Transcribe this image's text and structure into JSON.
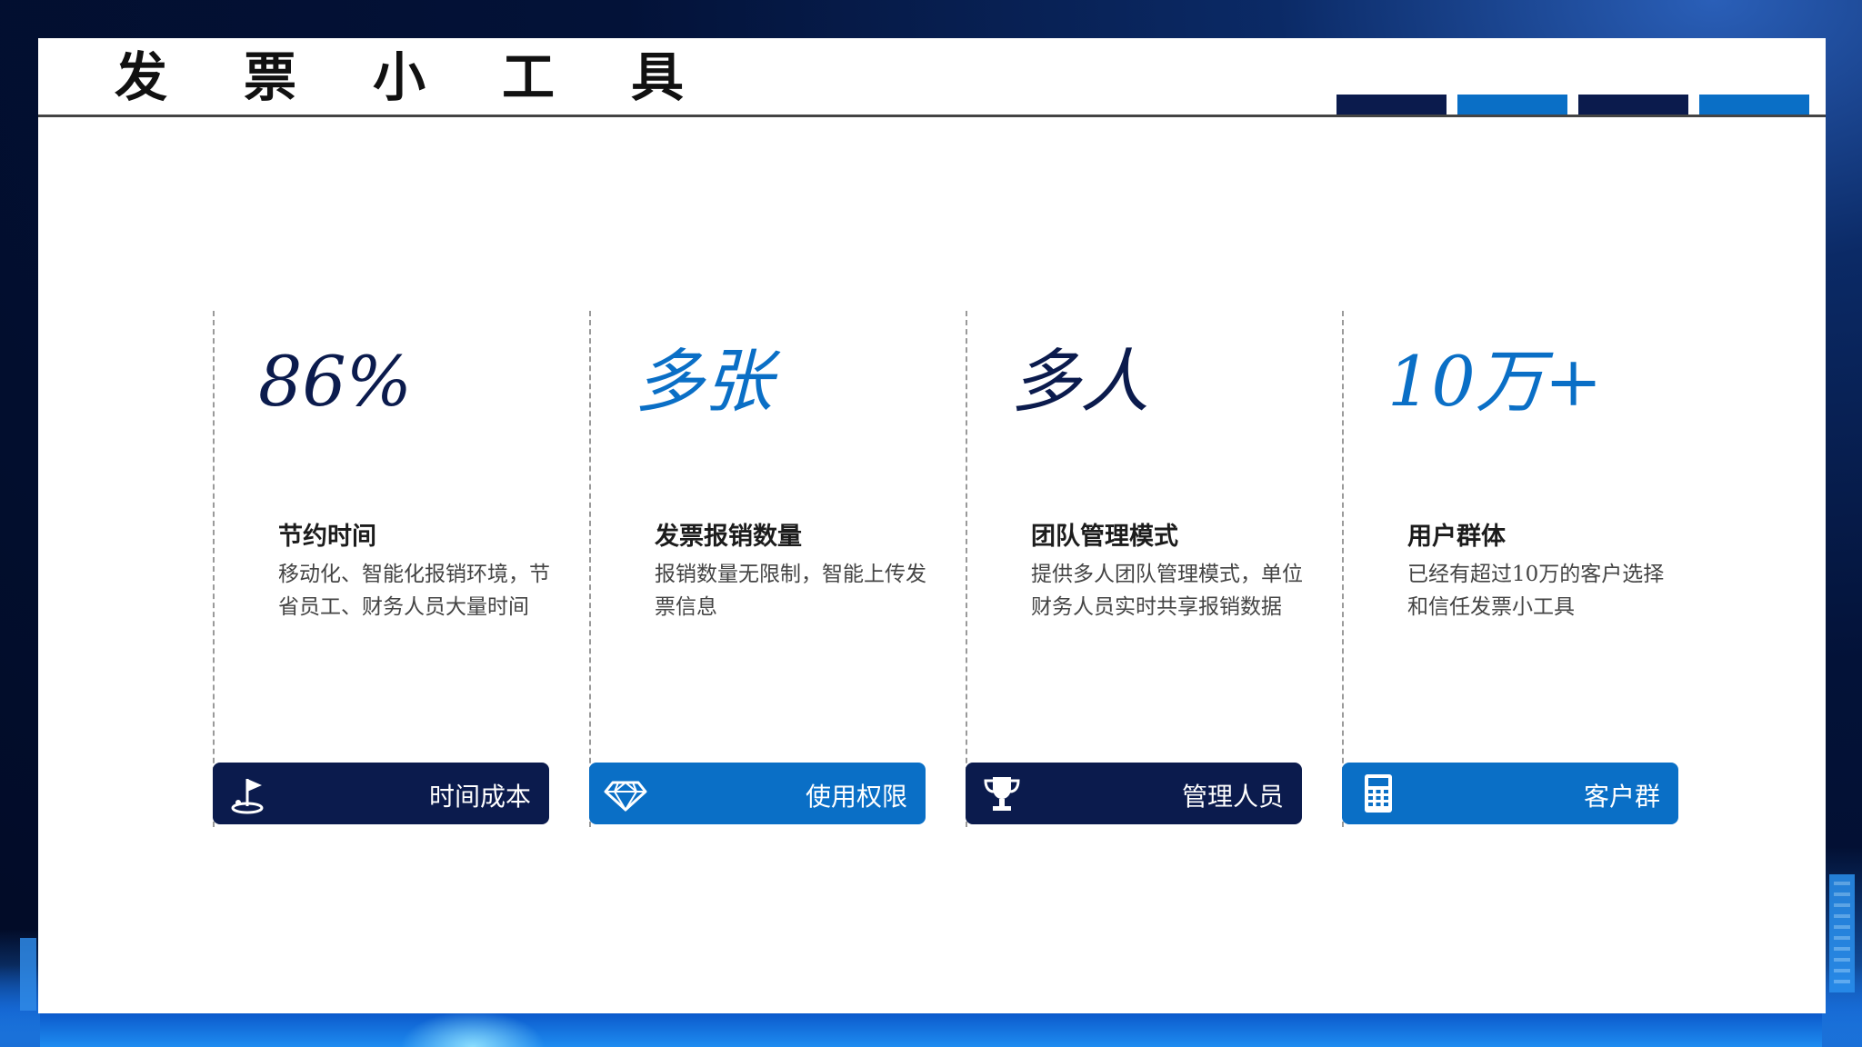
{
  "title": "发票小工具",
  "colors": {
    "navy": "#0b1b4d",
    "blue": "#0a6fc6",
    "page_bg": "#031238"
  },
  "header_bars": [
    "navy",
    "blue",
    "navy",
    "blue"
  ],
  "columns": [
    {
      "big": "86%",
      "heading": "节约时间",
      "desc": "移动化、智能化报销环境，节省员工、财务人员大量时间",
      "label": "时间成本",
      "icon": "golf-flag-icon",
      "theme": "navy"
    },
    {
      "big": "多张",
      "heading": "发票报销数量",
      "desc": "报销数量无限制，智能上传发票信息",
      "label": "使用权限",
      "icon": "diamond-icon",
      "theme": "blue"
    },
    {
      "big": "多人",
      "heading": "团队管理模式",
      "desc": "提供多人团队管理模式，单位财务人员实时共享报销数据",
      "label": "管理人员",
      "icon": "trophy-icon",
      "theme": "navy"
    },
    {
      "big": "10万+",
      "heading": "用户群体",
      "desc": "已经有超过10万的客户选择和信任发票小工具",
      "label": "客户群",
      "icon": "calculator-icon",
      "theme": "blue"
    }
  ]
}
